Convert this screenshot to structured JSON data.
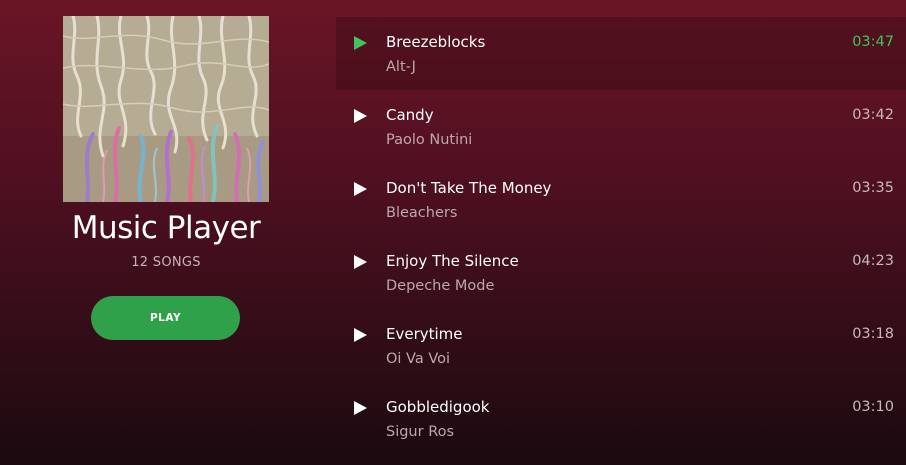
{
  "player": {
    "title": "Music Player",
    "song_count": "12 SONGS",
    "play_label": "PLAY"
  },
  "colors": {
    "accent_green": "#2ea14a",
    "active_duration": "#3ec45a",
    "background_top": "#6a1526",
    "background_bottom": "#1a0a0f"
  },
  "tracks": [
    {
      "name": "Breezeblocks",
      "artist": "Alt-J",
      "duration": "03:47",
      "active": true,
      "icon": "play-icon"
    },
    {
      "name": "Candy",
      "artist": "Paolo Nutini",
      "duration": "03:42",
      "active": false,
      "icon": "play-icon"
    },
    {
      "name": "Don't Take The Money",
      "artist": "Bleachers",
      "duration": "03:35",
      "active": false,
      "icon": "play-icon"
    },
    {
      "name": "Enjoy The Silence",
      "artist": "Depeche Mode",
      "duration": "04:23",
      "active": false,
      "icon": "play-icon"
    },
    {
      "name": "Everytime",
      "artist": "Oi Va Voi",
      "duration": "03:18",
      "active": false,
      "icon": "play-icon"
    },
    {
      "name": "Gobbledigook",
      "artist": "Sigur Ros",
      "duration": "03:10",
      "active": false,
      "icon": "play-icon"
    }
  ]
}
